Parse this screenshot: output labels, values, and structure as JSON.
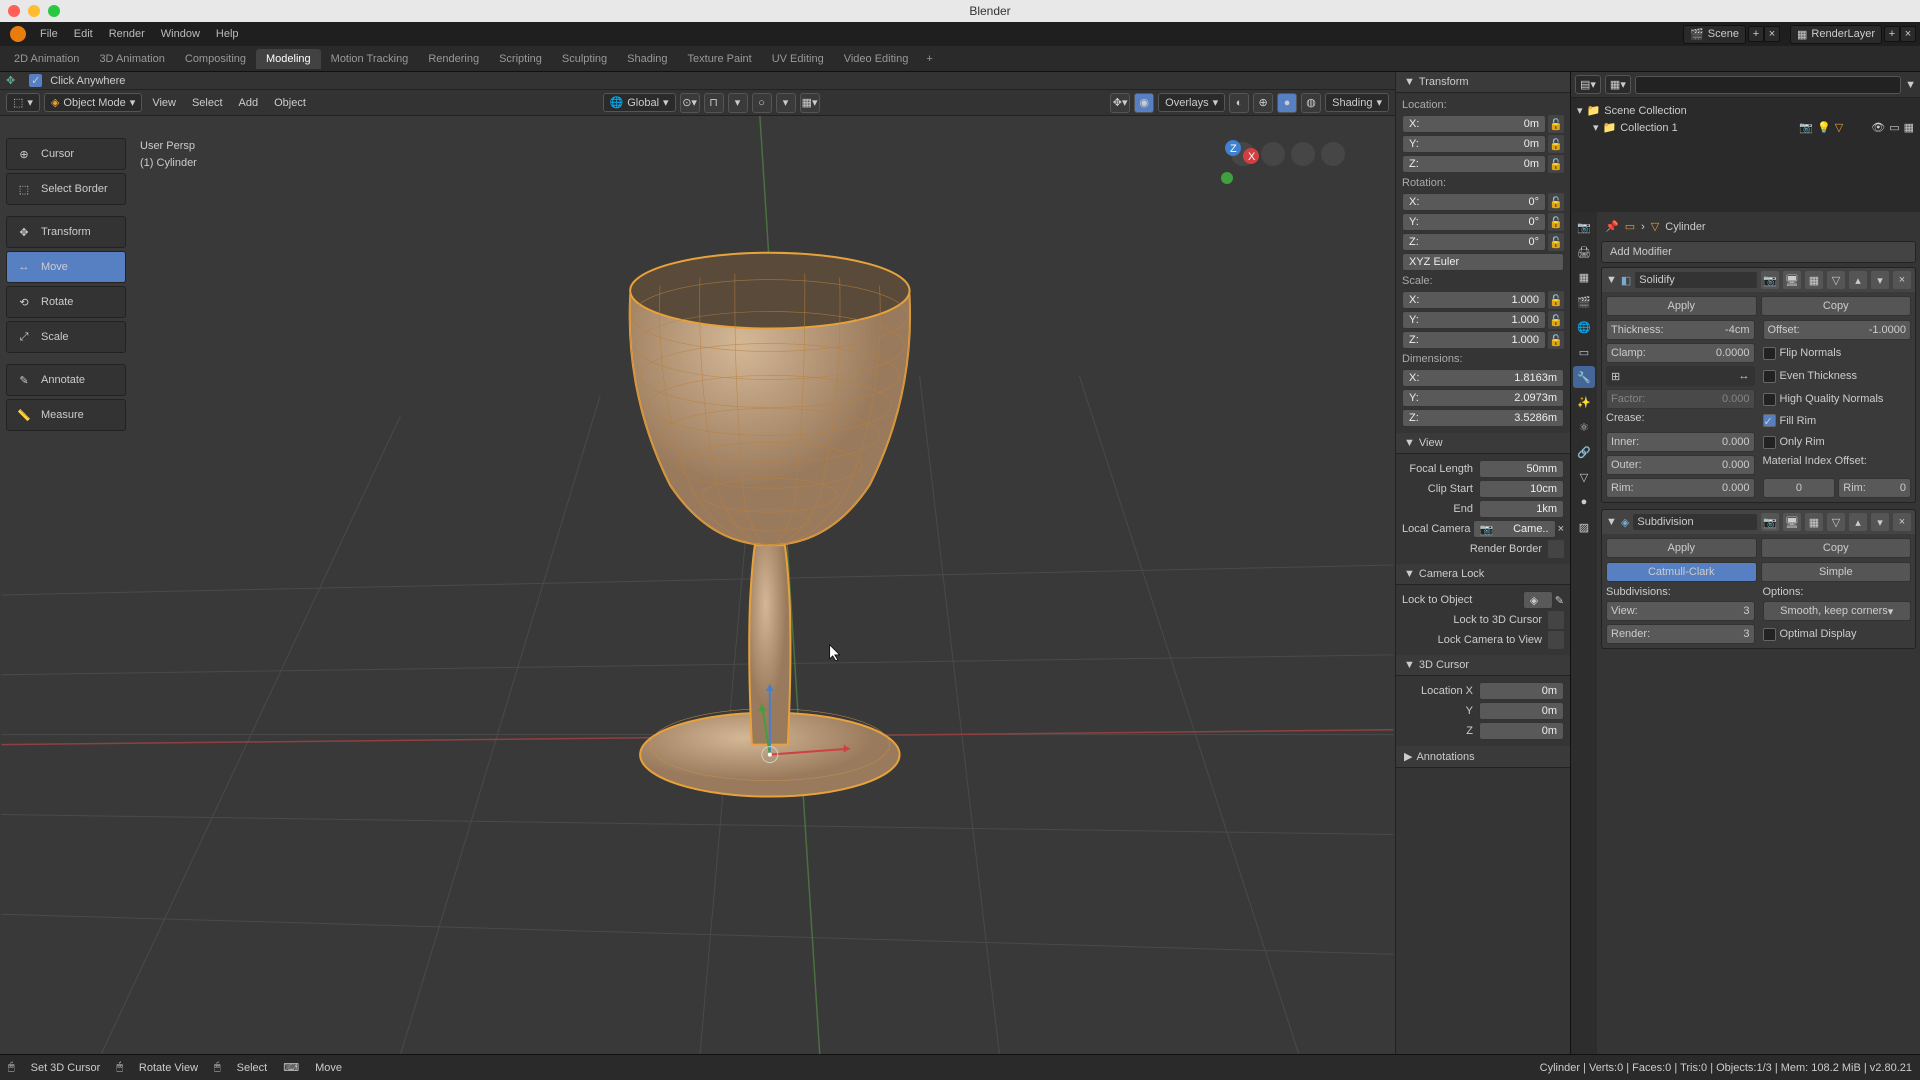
{
  "app_title": "Blender",
  "menubar": {
    "items": [
      "File",
      "Edit",
      "Render",
      "Window",
      "Help"
    ],
    "scene_label": "Scene",
    "layer_label": "RenderLayer"
  },
  "workspaces": {
    "tabs": [
      "2D Animation",
      "3D Animation",
      "Compositing",
      "Modeling",
      "Motion Tracking",
      "Rendering",
      "Scripting",
      "Sculpting",
      "Shading",
      "Texture Paint",
      "UV Editing",
      "Video Editing"
    ],
    "active": 3
  },
  "viewport_header": {
    "editor_icon": "cube",
    "mode": "Object Mode",
    "menus": [
      "View",
      "Select",
      "Add",
      "Object"
    ],
    "orient": "Global",
    "overlays_label": "Overlays",
    "shading_label": "Shading"
  },
  "click_anywhere": "Click Anywhere",
  "tools": [
    {
      "name": "Cursor",
      "icon": "cursor"
    },
    {
      "name": "Select Border",
      "icon": "select"
    },
    {
      "name": "Transform",
      "icon": "transform",
      "sep_before": true
    },
    {
      "name": "Move",
      "icon": "move",
      "active": true
    },
    {
      "name": "Rotate",
      "icon": "rotate"
    },
    {
      "name": "Scale",
      "icon": "scale"
    },
    {
      "name": "Annotate",
      "icon": "annotate",
      "sep_before": true
    },
    {
      "name": "Measure",
      "icon": "measure"
    }
  ],
  "vp_info": {
    "persp": "User Persp",
    "obj": "(1) Cylinder"
  },
  "n_panel": {
    "transform": {
      "title": "Transform",
      "location": {
        "label": "Location:",
        "x": "0m",
        "y": "0m",
        "z": "0m"
      },
      "rotation": {
        "label": "Rotation:",
        "x": "0°",
        "y": "0°",
        "z": "0°",
        "mode": "XYZ Euler"
      },
      "scale": {
        "label": "Scale:",
        "x": "1.000",
        "y": "1.000",
        "z": "1.000"
      },
      "dimensions": {
        "label": "Dimensions:",
        "x": "1.8163m",
        "y": "2.0973m",
        "z": "3.5286m"
      }
    },
    "view": {
      "title": "View",
      "focal": "Focal Length",
      "focal_v": "50mm",
      "clip_start": "Clip Start",
      "clip_start_v": "10cm",
      "clip_end": "End",
      "clip_end_v": "1km",
      "local_cam": "Local Camera",
      "cam_name": "Came..",
      "render_border": "Render Border"
    },
    "camlock": {
      "title": "Camera Lock",
      "lock_obj": "Lock to Object",
      "lock_cursor": "Lock to 3D Cursor",
      "lock_cam": "Lock Camera to View"
    },
    "cursor3d": {
      "title": "3D Cursor",
      "lx": "Location X",
      "v": "0m"
    },
    "annotations": {
      "title": "Annotations"
    }
  },
  "outliner": {
    "scene_coll": "Scene Collection",
    "coll1": "Collection 1"
  },
  "props": {
    "crumb_obj": "Cylinder",
    "add_modifier": "Add Modifier",
    "mod_solidify": {
      "name": "Solidify",
      "apply": "Apply",
      "copy": "Copy",
      "thickness": {
        "l": "Thickness:",
        "v": "-4cm"
      },
      "offset": {
        "l": "Offset:",
        "v": "-1.0000"
      },
      "clamp": {
        "l": "Clamp:",
        "v": "0.0000"
      },
      "flip_normals": "Flip Normals",
      "even": "Even Thickness",
      "hq": "High Quality Normals",
      "fill_rim": "Fill Rim",
      "only_rim": "Only Rim",
      "factor": {
        "l": "Factor:",
        "v": "0.000"
      },
      "crease": "Crease:",
      "inner": {
        "l": "Inner:",
        "v": "0.000"
      },
      "outer": {
        "l": "Outer:",
        "v": "0.000"
      },
      "rim": {
        "l": "Rim:",
        "v": "0.000"
      },
      "mat_offset": "Material Index Offset:",
      "mat_v": "0",
      "rim2": "Rim:",
      "rim2_v": "0"
    },
    "mod_subsurf": {
      "name": "Subdivision",
      "apply": "Apply",
      "copy": "Copy",
      "catmull": "Catmull-Clark",
      "simple": "Simple",
      "subdiv_label": "Subdivisions:",
      "options_label": "Options:",
      "view": {
        "l": "View:",
        "v": "3"
      },
      "render": {
        "l": "Render:",
        "v": "3"
      },
      "smooth": "Smooth, keep corners",
      "optimal": "Optimal Display"
    }
  },
  "statusbar": {
    "action": "Set 3D Cursor",
    "rotate": "Rotate View",
    "select": "Select",
    "move": "Move",
    "stats": "Cylinder | Verts:0 | Faces:0 | Tris:0 | Objects:1/3 | Mem: 108.2 MiB | v2.80.21"
  }
}
